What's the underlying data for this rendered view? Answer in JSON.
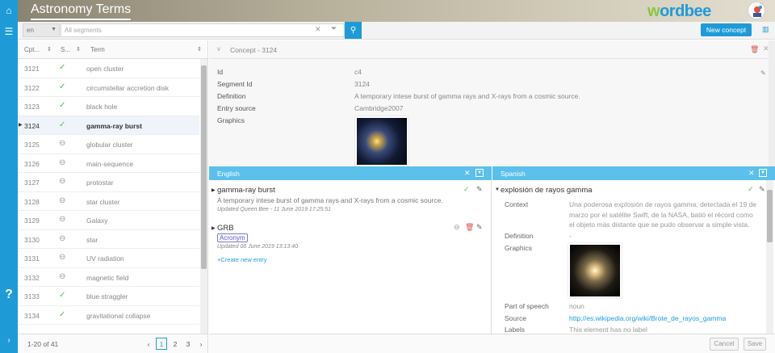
{
  "app": {
    "title": "Astronomy Terms",
    "logo_a": "w",
    "logo_b": "ordbee"
  },
  "toolbar": {
    "lang": "en",
    "search_placeholder": "All segments",
    "new_concept": "New concept"
  },
  "list": {
    "headers": {
      "id": "Cpt...",
      "status": "S...",
      "term": "Term"
    },
    "rows": [
      {
        "id": "3121",
        "status": "check",
        "term": "open cluster"
      },
      {
        "id": "3122",
        "status": "check",
        "term": "circumstellar accretion disk"
      },
      {
        "id": "3123",
        "status": "check",
        "term": "black hole"
      },
      {
        "id": "3124",
        "status": "check",
        "term": "gamma-ray burst",
        "selected": true
      },
      {
        "id": "3125",
        "status": "minus",
        "term": "globular cluster"
      },
      {
        "id": "3126",
        "status": "minus",
        "term": "main-sequence"
      },
      {
        "id": "3127",
        "status": "minus",
        "term": "protostar"
      },
      {
        "id": "3128",
        "status": "minus",
        "term": "star cluster"
      },
      {
        "id": "3129",
        "status": "minus",
        "term": "Galaxy"
      },
      {
        "id": "3130",
        "status": "minus",
        "term": "star"
      },
      {
        "id": "3131",
        "status": "minus",
        "term": "UV radiation"
      },
      {
        "id": "3132",
        "status": "minus",
        "term": "magnetic field"
      },
      {
        "id": "3133",
        "status": "check",
        "term": "blue straggler"
      },
      {
        "id": "3134",
        "status": "check",
        "term": "gravitational collapse"
      }
    ],
    "count": "1-20 of 41",
    "pages": [
      "1",
      "2",
      "3"
    ]
  },
  "concept": {
    "header": "Concept - 3124",
    "fields": [
      {
        "label": "Id",
        "value": "c4"
      },
      {
        "label": "Segment Id",
        "value": "3124"
      },
      {
        "label": "Definition",
        "value": "A temporary intese burst of gamma rays and X-rays from a cosmic source."
      },
      {
        "label": "Entry source",
        "value": "Cambridge2007"
      },
      {
        "label": "Graphics",
        "value": ""
      }
    ]
  },
  "english": {
    "lang": "English",
    "term1": "gamma-ray burst",
    "def1": "A temporary intese burst of gamma rays and X-rays from a cosmic source.",
    "upd1": "Updated Queen Bee - 11 June 2019 17:25:51",
    "term2": "GRB",
    "badge2": "Acronym",
    "upd2": "Updated 06 June 2019 13:13:40",
    "create": "+Create new entry"
  },
  "spanish": {
    "lang": "Spanish",
    "term": "explosión de rayos gamma",
    "context_label": "Context",
    "context_line1": "Una poderosa explosión de rayos gamma, detectada el 19 de",
    "context_line2": "marzo por el satélite Swift, de la NASA, batió el récord como",
    "context_line3": "el objeto más distante que se pudo observar a simple vista.",
    "definition_label": "Definition",
    "definition_value": "-",
    "graphics_label": "Graphics",
    "pos_label": "Part of speech",
    "pos_value": "noun",
    "source_label": "Source",
    "source_value": "http://es.wikipedia.org/wiki/Brote_de_rayos_gamma",
    "labels_label": "Labels",
    "labels_value": "This element has no label"
  },
  "actions": {
    "cancel": "Cancel",
    "save": "Save"
  }
}
